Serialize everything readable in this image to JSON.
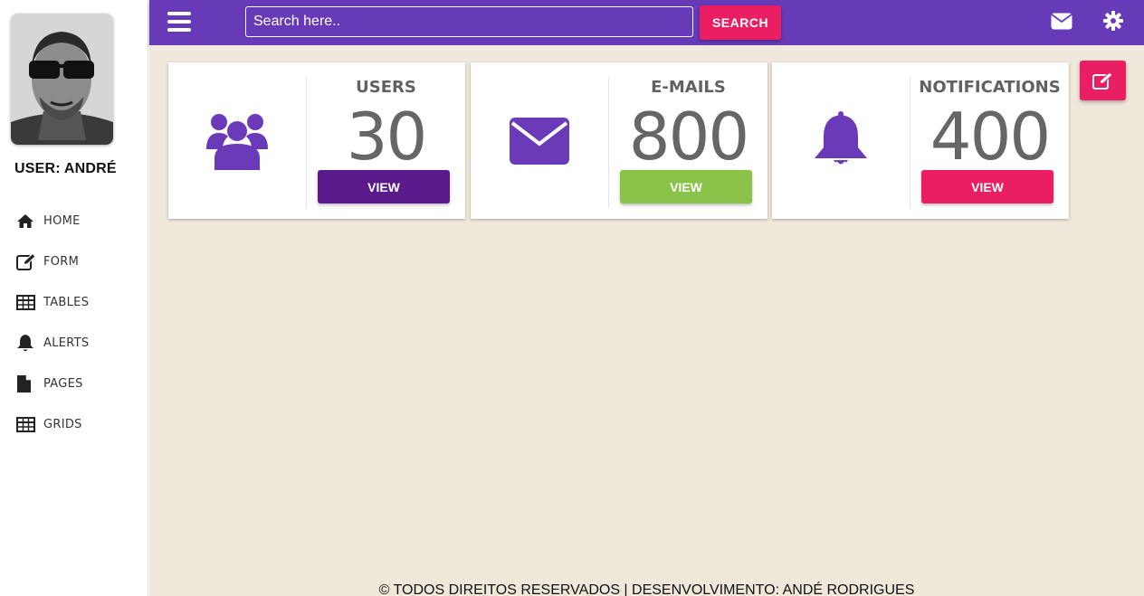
{
  "sidebar": {
    "user_label": "USER: ANDRÉ",
    "items": [
      {
        "label": "HOME",
        "icon": "home-icon"
      },
      {
        "label": "FORM",
        "icon": "edit-icon"
      },
      {
        "label": "TABLES",
        "icon": "table-icon"
      },
      {
        "label": "ALERTS",
        "icon": "bell-icon"
      },
      {
        "label": "PAGES",
        "icon": "file-icon"
      },
      {
        "label": "GRIDS",
        "icon": "grid-icon"
      }
    ]
  },
  "topbar": {
    "search_placeholder": "Search here..",
    "search_button": "SEARCH",
    "icons": [
      "menu-icon",
      "envelope-icon",
      "gear-icon"
    ]
  },
  "cards": [
    {
      "title": "USERS",
      "value": "30",
      "button": "VIEW",
      "icon": "users-icon",
      "button_color": "#5a1a8b"
    },
    {
      "title": "E-MAILS",
      "value": "800",
      "button": "VIEW",
      "icon": "envelope-icon",
      "button_color": "#8bc34a"
    },
    {
      "title": "NOTIFICATIONS",
      "value": "400",
      "button": "VIEW",
      "icon": "bell-icon",
      "button_color": "#e91e63"
    }
  ],
  "colors": {
    "topbar": "#673ab7",
    "accent": "#e91e63",
    "background": "#f0e8da",
    "icon": "#6a3ab8"
  },
  "footer": {
    "text": "© TODOS DIREITOS RESERVADOS | DESENVOLVIMENTO: ANDÉ RODRIGUES"
  }
}
